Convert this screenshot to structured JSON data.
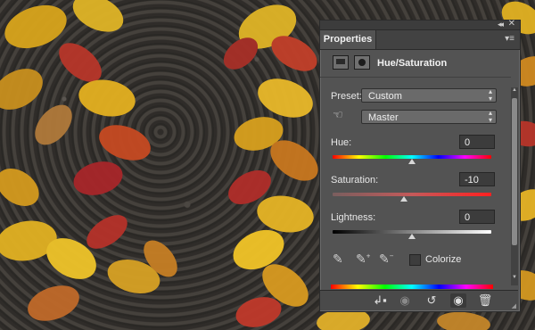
{
  "panel": {
    "tab_label": "Properties",
    "adjustment_title": "Hue/Saturation",
    "preset_label": "Preset:",
    "preset_value": "Custom",
    "channel_value": "Master",
    "hue_label": "Hue:",
    "hue_value": "0",
    "saturation_label": "Saturation:",
    "saturation_value": "-10",
    "lightness_label": "Lightness:",
    "lightness_value": "0",
    "colorize_label": "Colorize",
    "colorize_checked": false
  },
  "sliders": {
    "hue": 0,
    "saturation": -10,
    "lightness": 0
  },
  "icons": {
    "collapse": "double-chevron-icon",
    "close": "close-icon",
    "menu": "panel-menu-icon",
    "adjustment_layer": "adjustment-layer-icon",
    "mask": "mask-icon",
    "targeted_adjust": "hand-adjust-icon",
    "eyedropper": "eyedropper-icon",
    "eyedropper_plus": "eyedropper-plus-icon",
    "eyedropper_minus": "eyedropper-minus-icon",
    "clip": "clip-to-layer-icon",
    "view_previous": "view-previous-icon",
    "reset": "reset-icon",
    "visibility": "visibility-eye-icon",
    "delete": "trash-icon"
  }
}
